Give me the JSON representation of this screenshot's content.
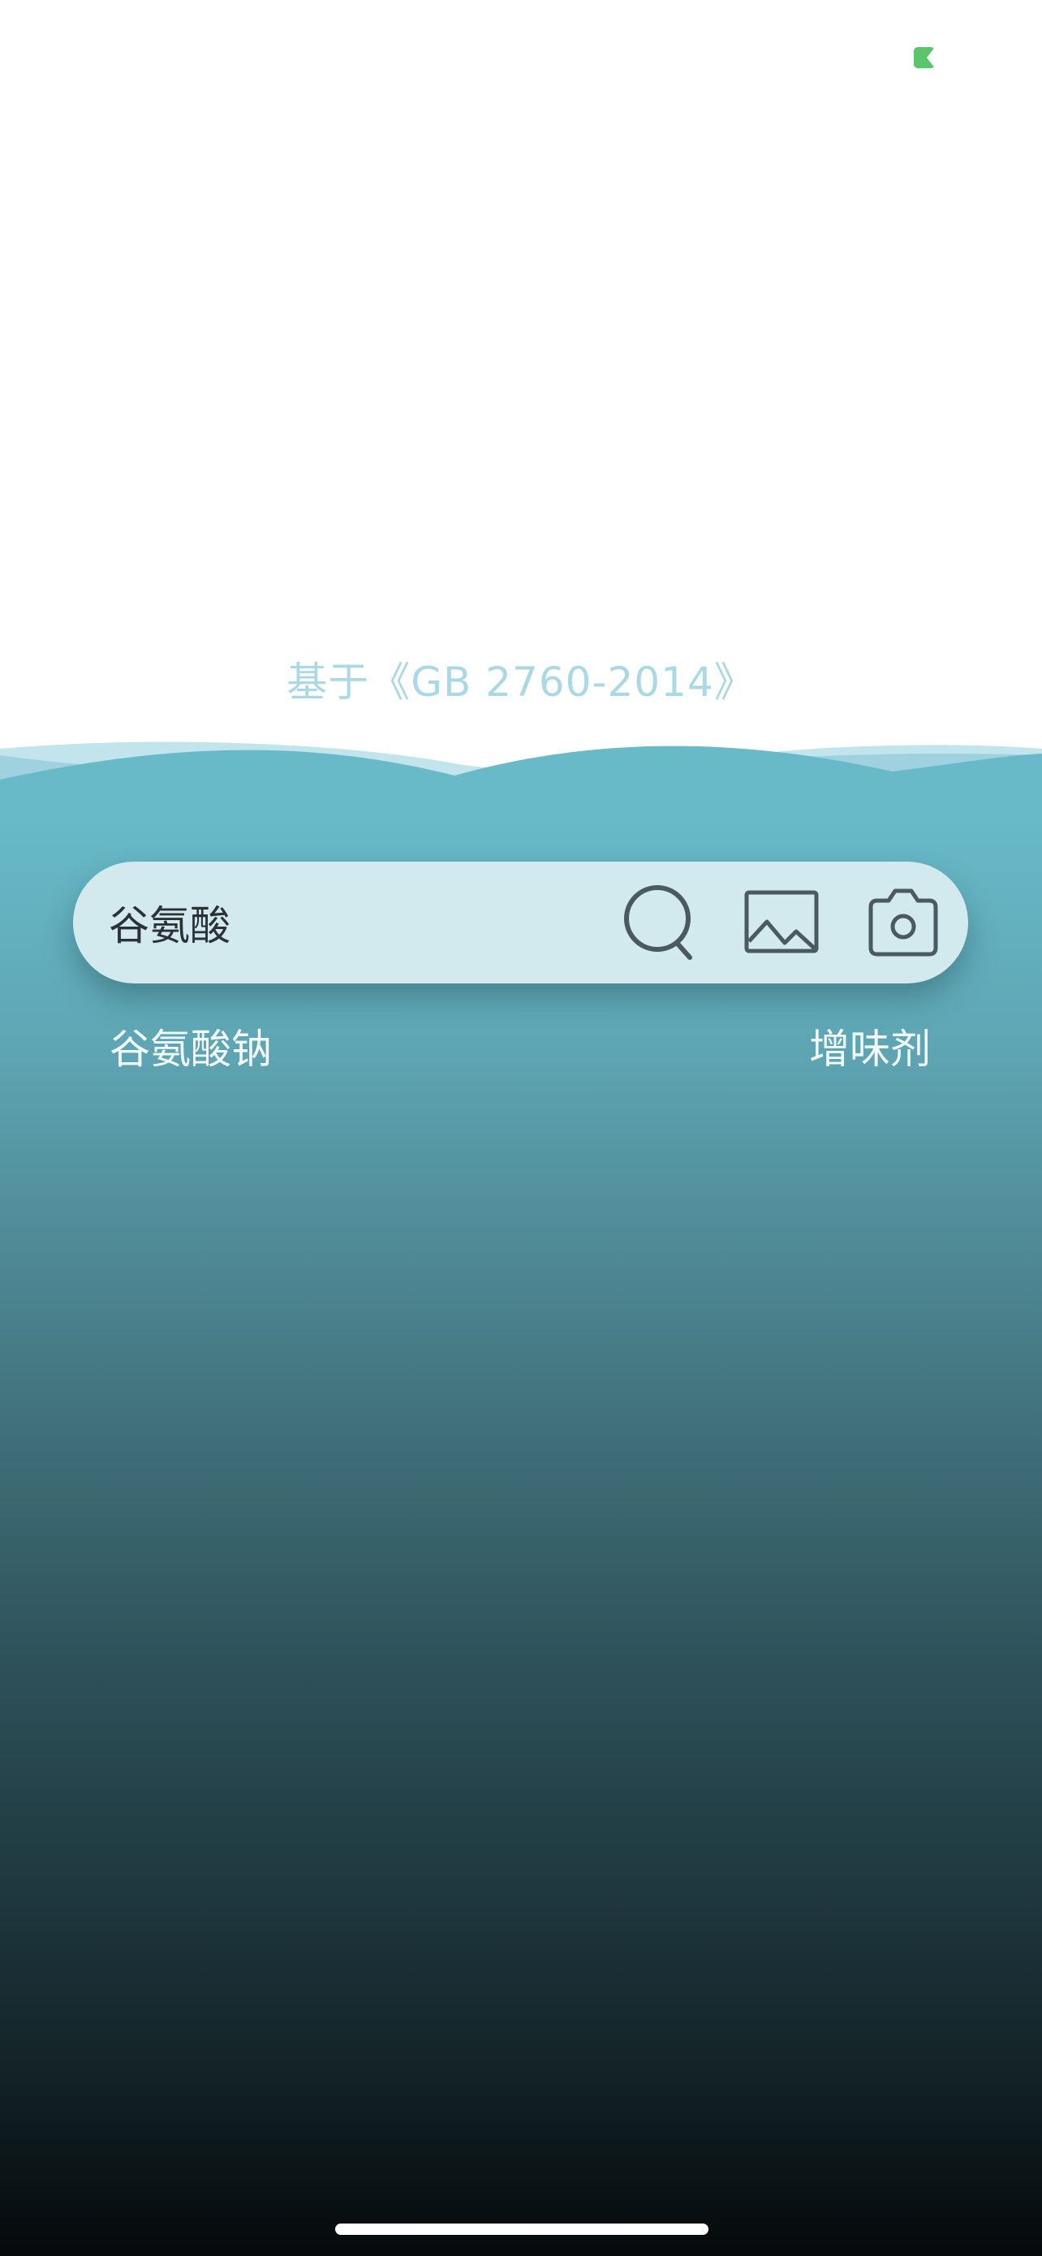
{
  "subtitle": "基于《GB 2760-2014》",
  "search": {
    "value": "谷氨酸",
    "icons": [
      "search-icon",
      "image-icon",
      "camera-icon"
    ]
  },
  "result": {
    "name": "谷氨酸钠",
    "category": "增味剂"
  },
  "colors": {
    "subtitle": "#aad9e5",
    "ocean_top": "#68bac9",
    "ocean_bottom": "#05090b",
    "search_bar": "#d2e9ee",
    "icon": "#4a5a60",
    "status_indicator": "#5cc46a"
  }
}
